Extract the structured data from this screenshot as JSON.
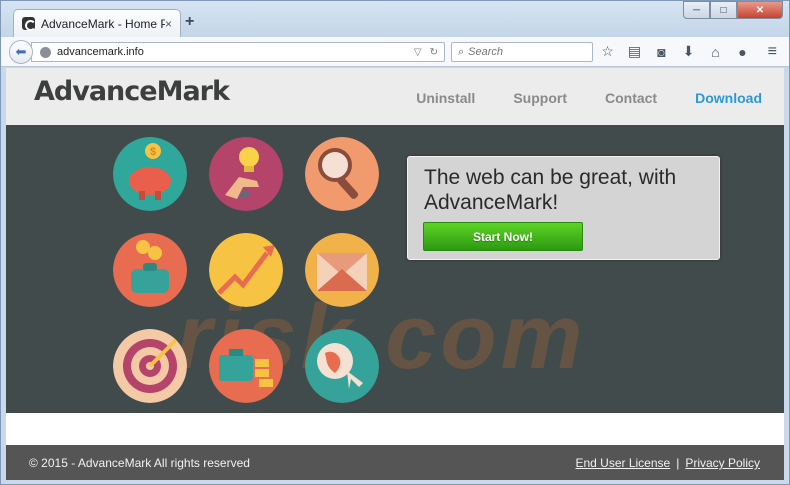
{
  "browser": {
    "tab_title": "AdvanceMark - Home Page",
    "tab_close": "×",
    "new_tab": "+",
    "url": "advancemark.info",
    "search_placeholder": "Search",
    "window_buttons": {
      "minimize": "─",
      "maximize": "□",
      "close": "✕"
    }
  },
  "site": {
    "logo": "AdvanceMark",
    "nav": [
      "Uninstall",
      "Support",
      "Contact",
      "Download"
    ],
    "hero": {
      "headline": "The web can be great, with AdvanceMark!",
      "cta": "Start Now!"
    },
    "watermark": "risk.com",
    "footer": {
      "copyright": "© 2015 - AdvanceMark All rights reserved",
      "links": [
        "End User License",
        "Privacy Policy"
      ],
      "separator": "|"
    }
  },
  "colors": {
    "accent": "#2a9ad6",
    "hero_bg": "#424b4b",
    "cta_green": "#3cb518",
    "footer_bg": "#555555"
  },
  "icons": [
    "piggy-bank-icon",
    "idea-hand-icon",
    "magnifier-icon",
    "wallet-coins-icon",
    "growth-chart-icon",
    "mail-envelope-icon",
    "target-icon",
    "briefcase-gold-icon",
    "globe-click-icon"
  ]
}
